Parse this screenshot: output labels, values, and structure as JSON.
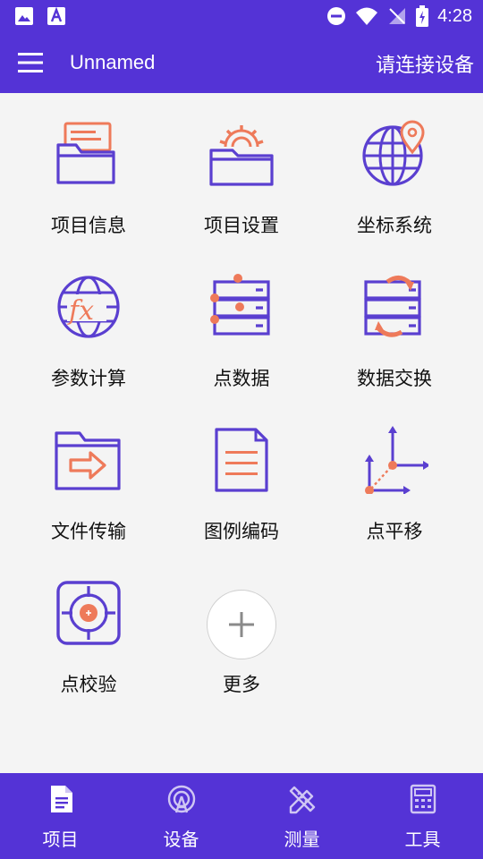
{
  "status_bar": {
    "time": "4:28"
  },
  "app_bar": {
    "title": "Unnamed",
    "connect_label": "请连接设备"
  },
  "grid": {
    "items": [
      {
        "label": "项目信息",
        "icon": "project-info-icon"
      },
      {
        "label": "项目设置",
        "icon": "project-settings-icon"
      },
      {
        "label": "坐标系统",
        "icon": "coordinate-system-icon"
      },
      {
        "label": "参数计算",
        "icon": "parameter-calc-icon"
      },
      {
        "label": "点数据",
        "icon": "point-data-icon"
      },
      {
        "label": "数据交换",
        "icon": "data-exchange-icon"
      },
      {
        "label": "文件传输",
        "icon": "file-transfer-icon"
      },
      {
        "label": "图例编码",
        "icon": "legend-code-icon"
      },
      {
        "label": "点平移",
        "icon": "point-translate-icon"
      },
      {
        "label": "点校验",
        "icon": "point-check-icon"
      },
      {
        "label": "更多",
        "icon": "plus-icon"
      }
    ]
  },
  "bottom_nav": {
    "tabs": [
      {
        "label": "项目",
        "icon": "project-doc-icon",
        "active": true
      },
      {
        "label": "设备",
        "icon": "device-antenna-icon",
        "active": false
      },
      {
        "label": "测量",
        "icon": "survey-pencil-icon",
        "active": false
      },
      {
        "label": "工具",
        "icon": "calculator-icon",
        "active": false
      }
    ]
  },
  "colors": {
    "primary": "#5433d6",
    "icon_stroke": "#5a3fd0",
    "accent": "#ee7a5a",
    "background": "#f4f4f4"
  }
}
